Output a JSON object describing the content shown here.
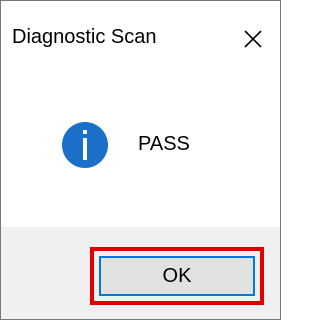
{
  "window": {
    "title": "Diagnostic Scan",
    "close_icon": "close-icon"
  },
  "message": {
    "icon": "info-icon",
    "text": "PASS"
  },
  "buttons": {
    "ok_label": "OK"
  },
  "colors": {
    "info_icon": "#1a6fc9",
    "highlight": "#e00000",
    "button_border": "#0078d7",
    "footer_bg": "#f0f0f0"
  }
}
